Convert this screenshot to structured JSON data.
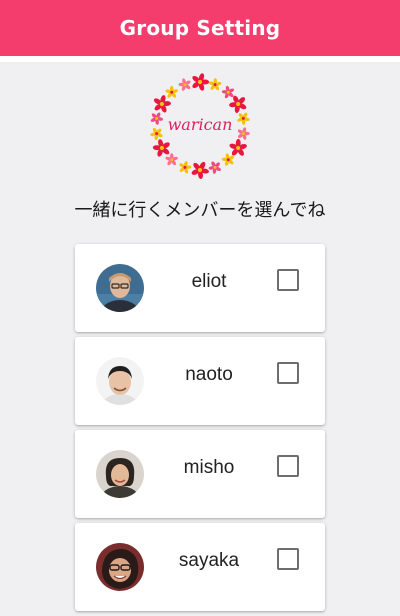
{
  "header": {
    "title": "Group Setting",
    "color": "#f43d6d"
  },
  "logo": {
    "text": "warican",
    "text_color": "#d8245e"
  },
  "prompt": "一緒に行くメンバーを選んでね",
  "members": [
    {
      "name": "eliot",
      "checked": false
    },
    {
      "name": "naoto",
      "checked": false
    },
    {
      "name": "misho",
      "checked": false
    },
    {
      "name": "sayaka",
      "checked": false
    }
  ]
}
